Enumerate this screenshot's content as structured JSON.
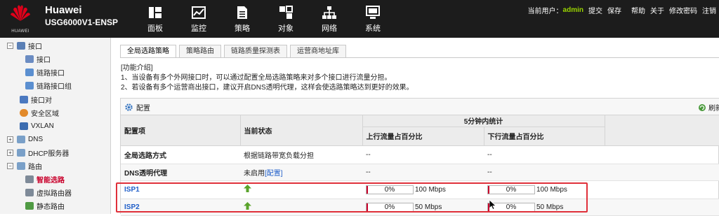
{
  "brand": {
    "logo_text": "HUAWEI",
    "name": "Huawei",
    "model": "USG6000V1-ENSP"
  },
  "nav": [
    {
      "label": "面板",
      "icon": "dashboard-icon"
    },
    {
      "label": "监控",
      "icon": "monitor-icon"
    },
    {
      "label": "策略",
      "icon": "policy-icon"
    },
    {
      "label": "对象",
      "icon": "object-icon"
    },
    {
      "label": "网络",
      "icon": "network-icon"
    },
    {
      "label": "系统",
      "icon": "system-icon"
    }
  ],
  "top_right": {
    "current_user_label": "当前用户：",
    "user": "admin",
    "commit": "提交",
    "save": "保存",
    "help": "帮助",
    "about": "关于",
    "change_password": "修改密码",
    "logout": "注销"
  },
  "sidebar": {
    "items": [
      {
        "label": "接口",
        "toggle": "−",
        "icon_color": "#5a7fb5"
      },
      {
        "label": "接口",
        "icon_color": "#6b8cc2"
      },
      {
        "label": "链路接口",
        "icon_color": "#5b8fd0"
      },
      {
        "label": "链路接口组",
        "icon_color": "#5b8fd0"
      },
      {
        "label": "接口对",
        "icon_color": "#4b79c0"
      },
      {
        "label": "安全区域",
        "icon_color": "#e28a2b"
      },
      {
        "label": "VXLAN",
        "icon_color": "#3d6db0"
      },
      {
        "label": "DNS",
        "toggle": "+",
        "icon_color": "#7aa0c8"
      },
      {
        "label": "DHCP服务器",
        "toggle": "+",
        "icon_color": "#7aa0c8"
      },
      {
        "label": "路由",
        "toggle": "−",
        "icon_color": "#7aa0c8"
      },
      {
        "label": "智能选路",
        "icon_color": "#7e8a98"
      },
      {
        "label": "虚拟路由器",
        "icon_color": "#7e8a98"
      },
      {
        "label": "静态路由",
        "icon_color": "#4f9a43"
      }
    ]
  },
  "tabs": [
    {
      "label": "全局选路策略"
    },
    {
      "label": "策略路由"
    },
    {
      "label": "链路质量探测表"
    },
    {
      "label": "运营商地址库"
    }
  ],
  "intro": {
    "title": "[功能介绍]",
    "line1": "1、当设备有多个外网接口时，可以通过配置全局选路策略来对多个接口进行流量分担。",
    "line2": "2、若设备有多个运营商出接口，建议开启DNS透明代理，这样会使选路策略达到更好的效果。"
  },
  "panel": {
    "config_label": "配置",
    "refresh_label": "刷新"
  },
  "table": {
    "headers": {
      "item": "配置项",
      "status": "当前状态",
      "stats": "5分钟内统计",
      "up": "上行流量占百分比",
      "down": "下行流量占百分比"
    },
    "rows": [
      {
        "item": "全局选路方式",
        "status": "根据链路带宽负载分担",
        "up": "--",
        "down": "--"
      },
      {
        "item": "DNS透明代理",
        "status": "未启用",
        "status_link": "[配置]",
        "up": "--",
        "down": "--"
      }
    ],
    "isp_rows": [
      {
        "item": "ISP1",
        "up_pct": "0%",
        "up_bw": "100 Mbps",
        "down_pct": "0%",
        "down_bw": "100 Mbps"
      },
      {
        "item": "ISP2",
        "up_pct": "0%",
        "up_bw": "50 Mbps",
        "down_pct": "0%",
        "down_bw": "50 Mbps"
      }
    ]
  },
  "colors": {
    "topbar": "#1c1c1c",
    "accent_red": "#c9002b",
    "link_blue": "#1e5dc8",
    "user_green": "#9ad400",
    "highlight": "#e0303a"
  }
}
